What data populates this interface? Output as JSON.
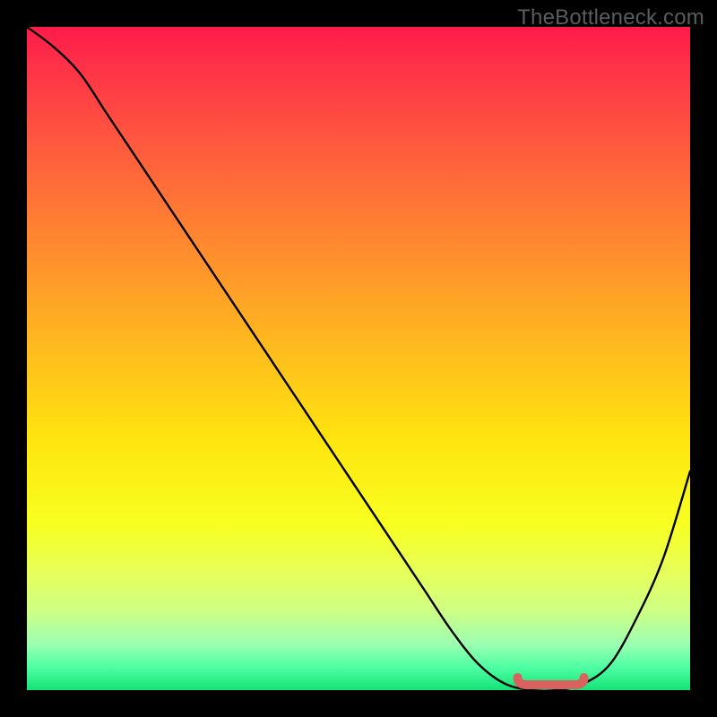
{
  "watermark": "TheBottleneck.com",
  "colors": {
    "curve": "#000000",
    "marker": "#d9625f",
    "gradient_top": "#ff1b4a",
    "gradient_bottom": "#14e277",
    "frame": "#000000"
  },
  "chart_data": {
    "type": "line",
    "title": "",
    "xlabel": "",
    "ylabel": "",
    "xlim": [
      0,
      100
    ],
    "ylim": [
      0,
      100
    ],
    "grid": false,
    "legend": false,
    "series": [
      {
        "name": "bottleneck_curve",
        "x": [
          0,
          4,
          8,
          12,
          16,
          20,
          24,
          28,
          32,
          36,
          40,
          44,
          48,
          52,
          56,
          60,
          64,
          68,
          72,
          76,
          80,
          84,
          88,
          92,
          96,
          100
        ],
        "y": [
          100,
          97,
          93,
          87,
          81,
          75,
          69,
          63,
          57,
          51,
          45,
          39,
          33,
          27,
          21,
          15,
          9,
          4,
          1,
          0,
          0,
          1,
          4,
          11,
          20,
          33
        ]
      }
    ],
    "optimal_region": {
      "x_start": 74,
      "x_end": 84,
      "y": 0
    }
  }
}
